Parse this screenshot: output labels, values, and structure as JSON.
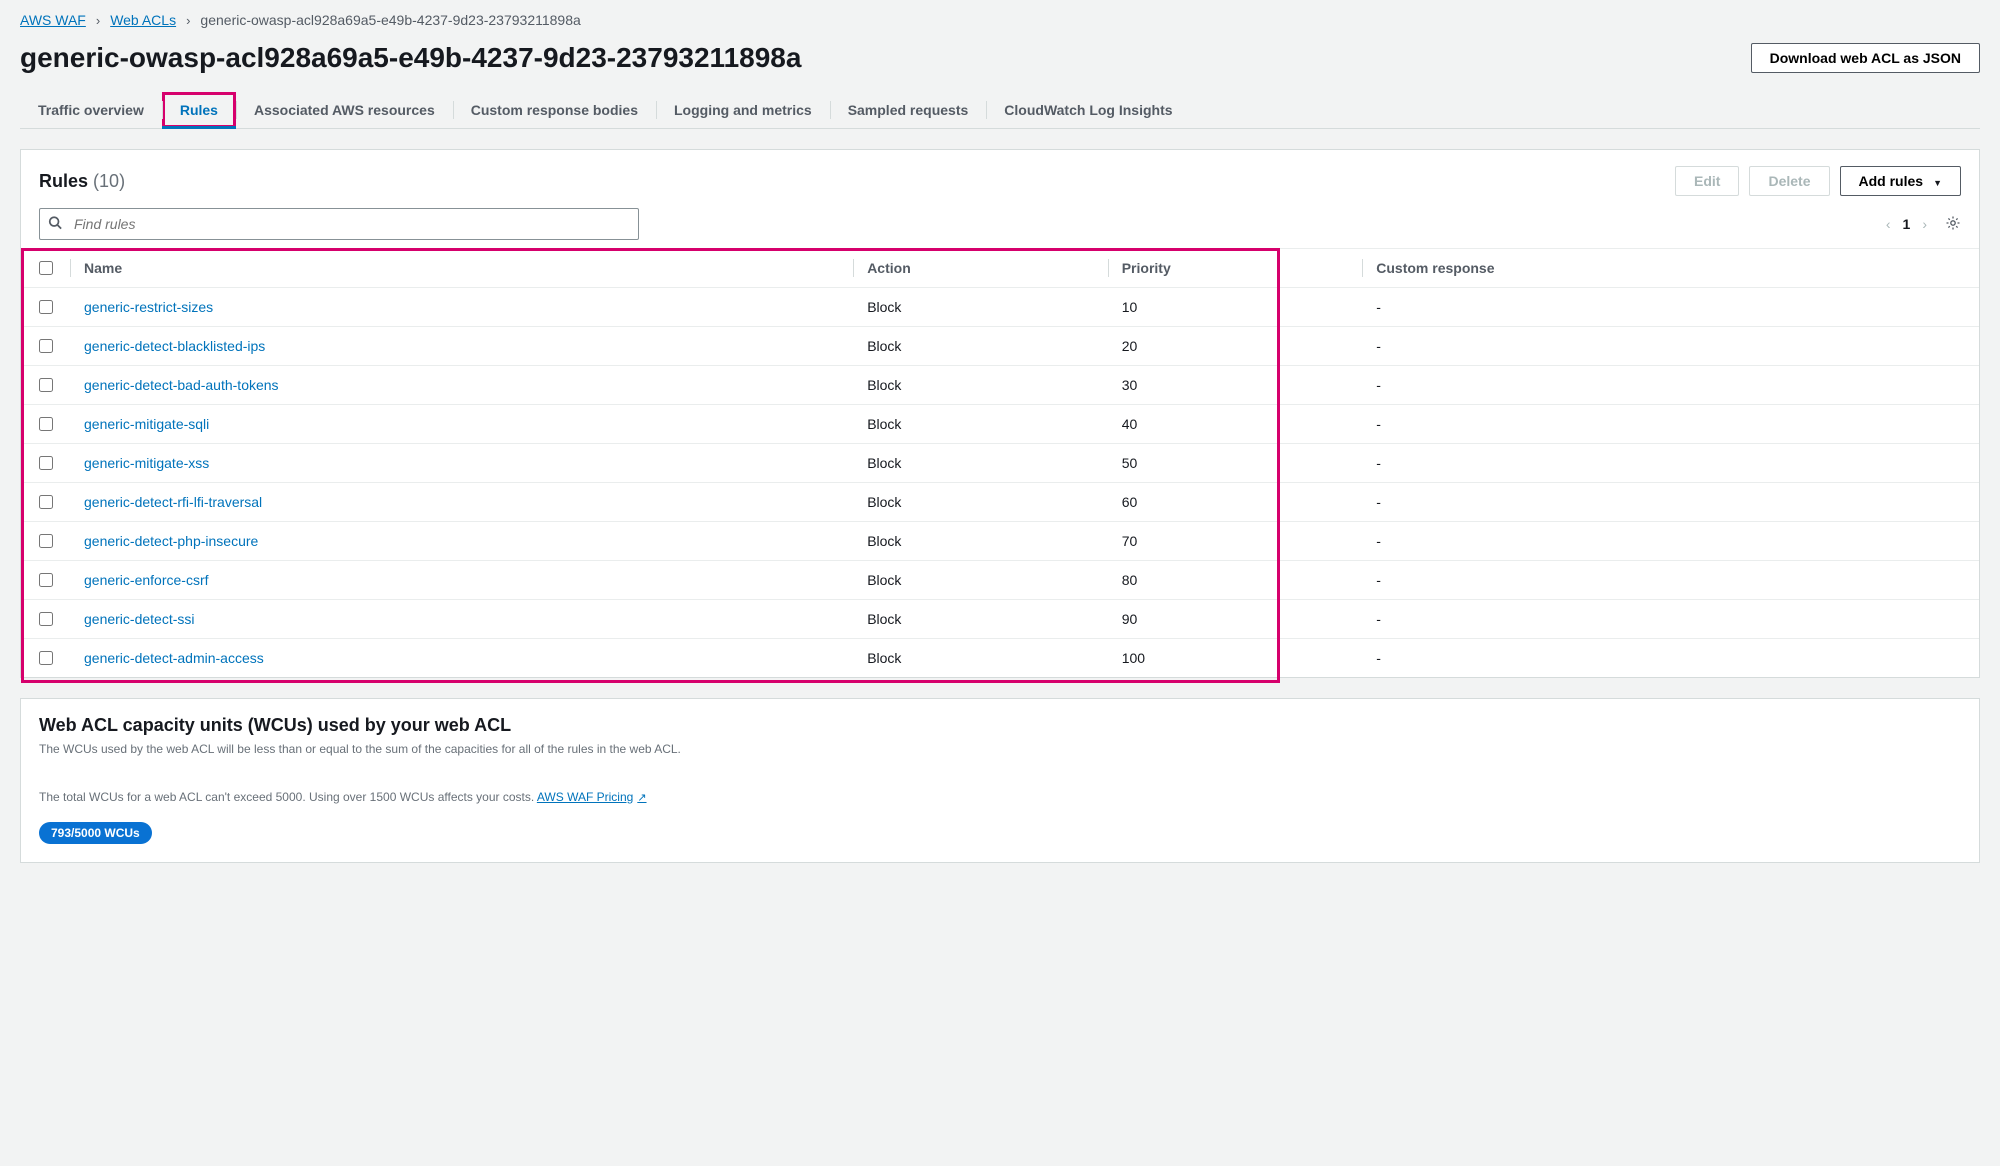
{
  "breadcrumb": {
    "l1": "AWS WAF",
    "l2": "Web ACLs",
    "current": "generic-owasp-acl928a69a5-e49b-4237-9d23-23793211898a"
  },
  "header": {
    "title": "generic-owasp-acl928a69a5-e49b-4237-9d23-23793211898a",
    "download_btn": "Download web ACL as JSON"
  },
  "tabs": [
    {
      "label": "Traffic overview",
      "active": false
    },
    {
      "label": "Rules",
      "active": true,
      "highlight": true
    },
    {
      "label": "Associated AWS resources",
      "active": false
    },
    {
      "label": "Custom response bodies",
      "active": false
    },
    {
      "label": "Logging and metrics",
      "active": false
    },
    {
      "label": "Sampled requests",
      "active": false
    },
    {
      "label": "CloudWatch Log Insights",
      "active": false
    }
  ],
  "rules_panel": {
    "title": "Rules",
    "count": "(10)",
    "edit_btn": "Edit",
    "delete_btn": "Delete",
    "add_btn": "Add rules",
    "search_placeholder": "Find rules",
    "page": "1",
    "columns": {
      "name": "Name",
      "action": "Action",
      "priority": "Priority",
      "custom": "Custom response"
    },
    "rows": [
      {
        "name": "generic-restrict-sizes",
        "action": "Block",
        "priority": "10",
        "custom": "-"
      },
      {
        "name": "generic-detect-blacklisted-ips",
        "action": "Block",
        "priority": "20",
        "custom": "-"
      },
      {
        "name": "generic-detect-bad-auth-tokens",
        "action": "Block",
        "priority": "30",
        "custom": "-"
      },
      {
        "name": "generic-mitigate-sqli",
        "action": "Block",
        "priority": "40",
        "custom": "-"
      },
      {
        "name": "generic-mitigate-xss",
        "action": "Block",
        "priority": "50",
        "custom": "-"
      },
      {
        "name": "generic-detect-rfi-lfi-traversal",
        "action": "Block",
        "priority": "60",
        "custom": "-"
      },
      {
        "name": "generic-detect-php-insecure",
        "action": "Block",
        "priority": "70",
        "custom": "-"
      },
      {
        "name": "generic-enforce-csrf",
        "action": "Block",
        "priority": "80",
        "custom": "-"
      },
      {
        "name": "generic-detect-ssi",
        "action": "Block",
        "priority": "90",
        "custom": "-"
      },
      {
        "name": "generic-detect-admin-access",
        "action": "Block",
        "priority": "100",
        "custom": "-"
      }
    ]
  },
  "wcu": {
    "title": "Web ACL capacity units (WCUs) used by your web ACL",
    "desc": "The WCUs used by the web ACL will be less than or equal to the sum of the capacities for all of the rules in the web ACL.",
    "note_prefix": "The total WCUs for a web ACL can't exceed 5000. Using over 1500 WCUs affects your costs. ",
    "pricing_link": "AWS WAF Pricing",
    "badge": "793/5000 WCUs"
  }
}
